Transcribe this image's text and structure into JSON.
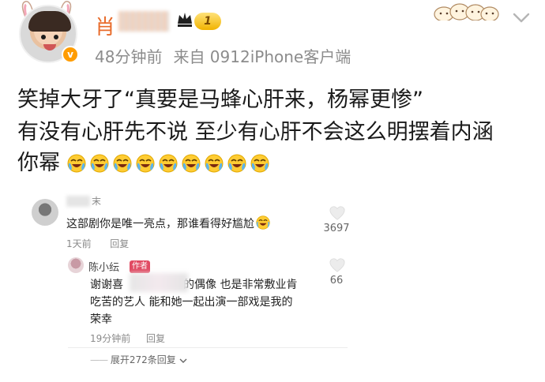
{
  "post": {
    "username_visible": "肖",
    "level": "1",
    "time": "48分钟前",
    "source": "来自 0912iPhone客户端",
    "text_lines": [
      "笑掉大牙了“真要是马蜂心肝来，杨幂更惨”",
      "有没有心肝先不说 至少有心肝不会这么明摆着内涵",
      "你幂"
    ]
  },
  "comments": [
    {
      "name_suffix": "末",
      "text": "这部剧你是唯一亮点，那谁看得好尴尬",
      "time": "1天前",
      "reply_label": "回复",
      "likes": "3697"
    }
  ],
  "reply": {
    "name": "陈小纭",
    "tag": "作者",
    "line1_a": "谢谢喜",
    "line1_b": "的偶像 也是非常敷业肯",
    "line2": "吃苦的艺人 能和她一起出演一部戏是我的",
    "line3": "荣幸",
    "time": "19分钟前",
    "reply_label": "回复",
    "likes": "66"
  },
  "expand_label": "展开272条回复",
  "icons": {
    "verified": "verified-badge-icon",
    "crown": "crown-icon",
    "emoji": "crying-laughing-emoji",
    "heart": "heart-outline-icon",
    "chevron": "chevron-down-icon"
  },
  "colors": {
    "username": "#e86b2a",
    "meta": "#8c8c8c",
    "verified": "#ff9c00",
    "author_tag": "#e14b63"
  }
}
